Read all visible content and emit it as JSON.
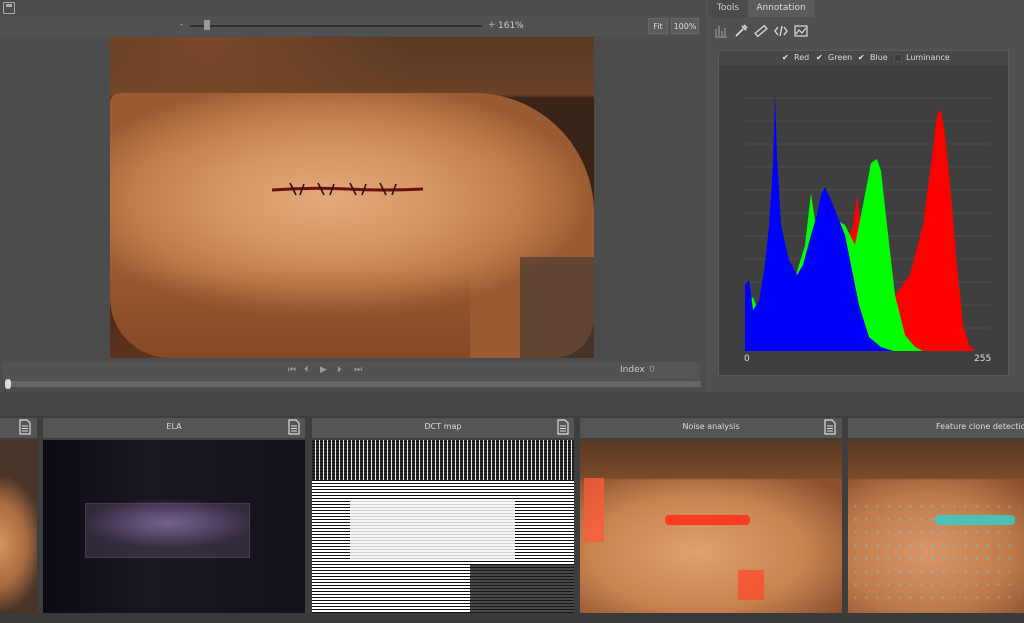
{
  "viewer": {
    "zoom_minus": "-",
    "zoom_plus": "+",
    "zoom_level": "161%",
    "fit_label": "Fit",
    "actual_size_label": "100%",
    "index_label": "Index:",
    "index_value": "0",
    "zoom_slider_fraction": 0.05,
    "timeline_position": 0
  },
  "tabs": [
    {
      "label": "Tools"
    },
    {
      "label": "Annotation"
    }
  ],
  "toolbar_icons": [
    "histogram-icon",
    "eyedropper-icon",
    "ruler-icon",
    "code-icon",
    "image-chart-icon"
  ],
  "histogram": {
    "legend": [
      {
        "label": "Red",
        "checked": true,
        "color": "#ff0000"
      },
      {
        "label": "Green",
        "checked": true,
        "color": "#00ff00"
      },
      {
        "label": "Blue",
        "checked": true,
        "color": "#0000ff"
      },
      {
        "label": "Luminance",
        "checked": false
      }
    ],
    "x_min_label": "0",
    "x_max_label": "255"
  },
  "thumbnails": [
    {
      "title": ""
    },
    {
      "title": "ELA"
    },
    {
      "title": "DCT map"
    },
    {
      "title": "Noise analysis"
    },
    {
      "title": "Feature clone detection"
    }
  ]
}
